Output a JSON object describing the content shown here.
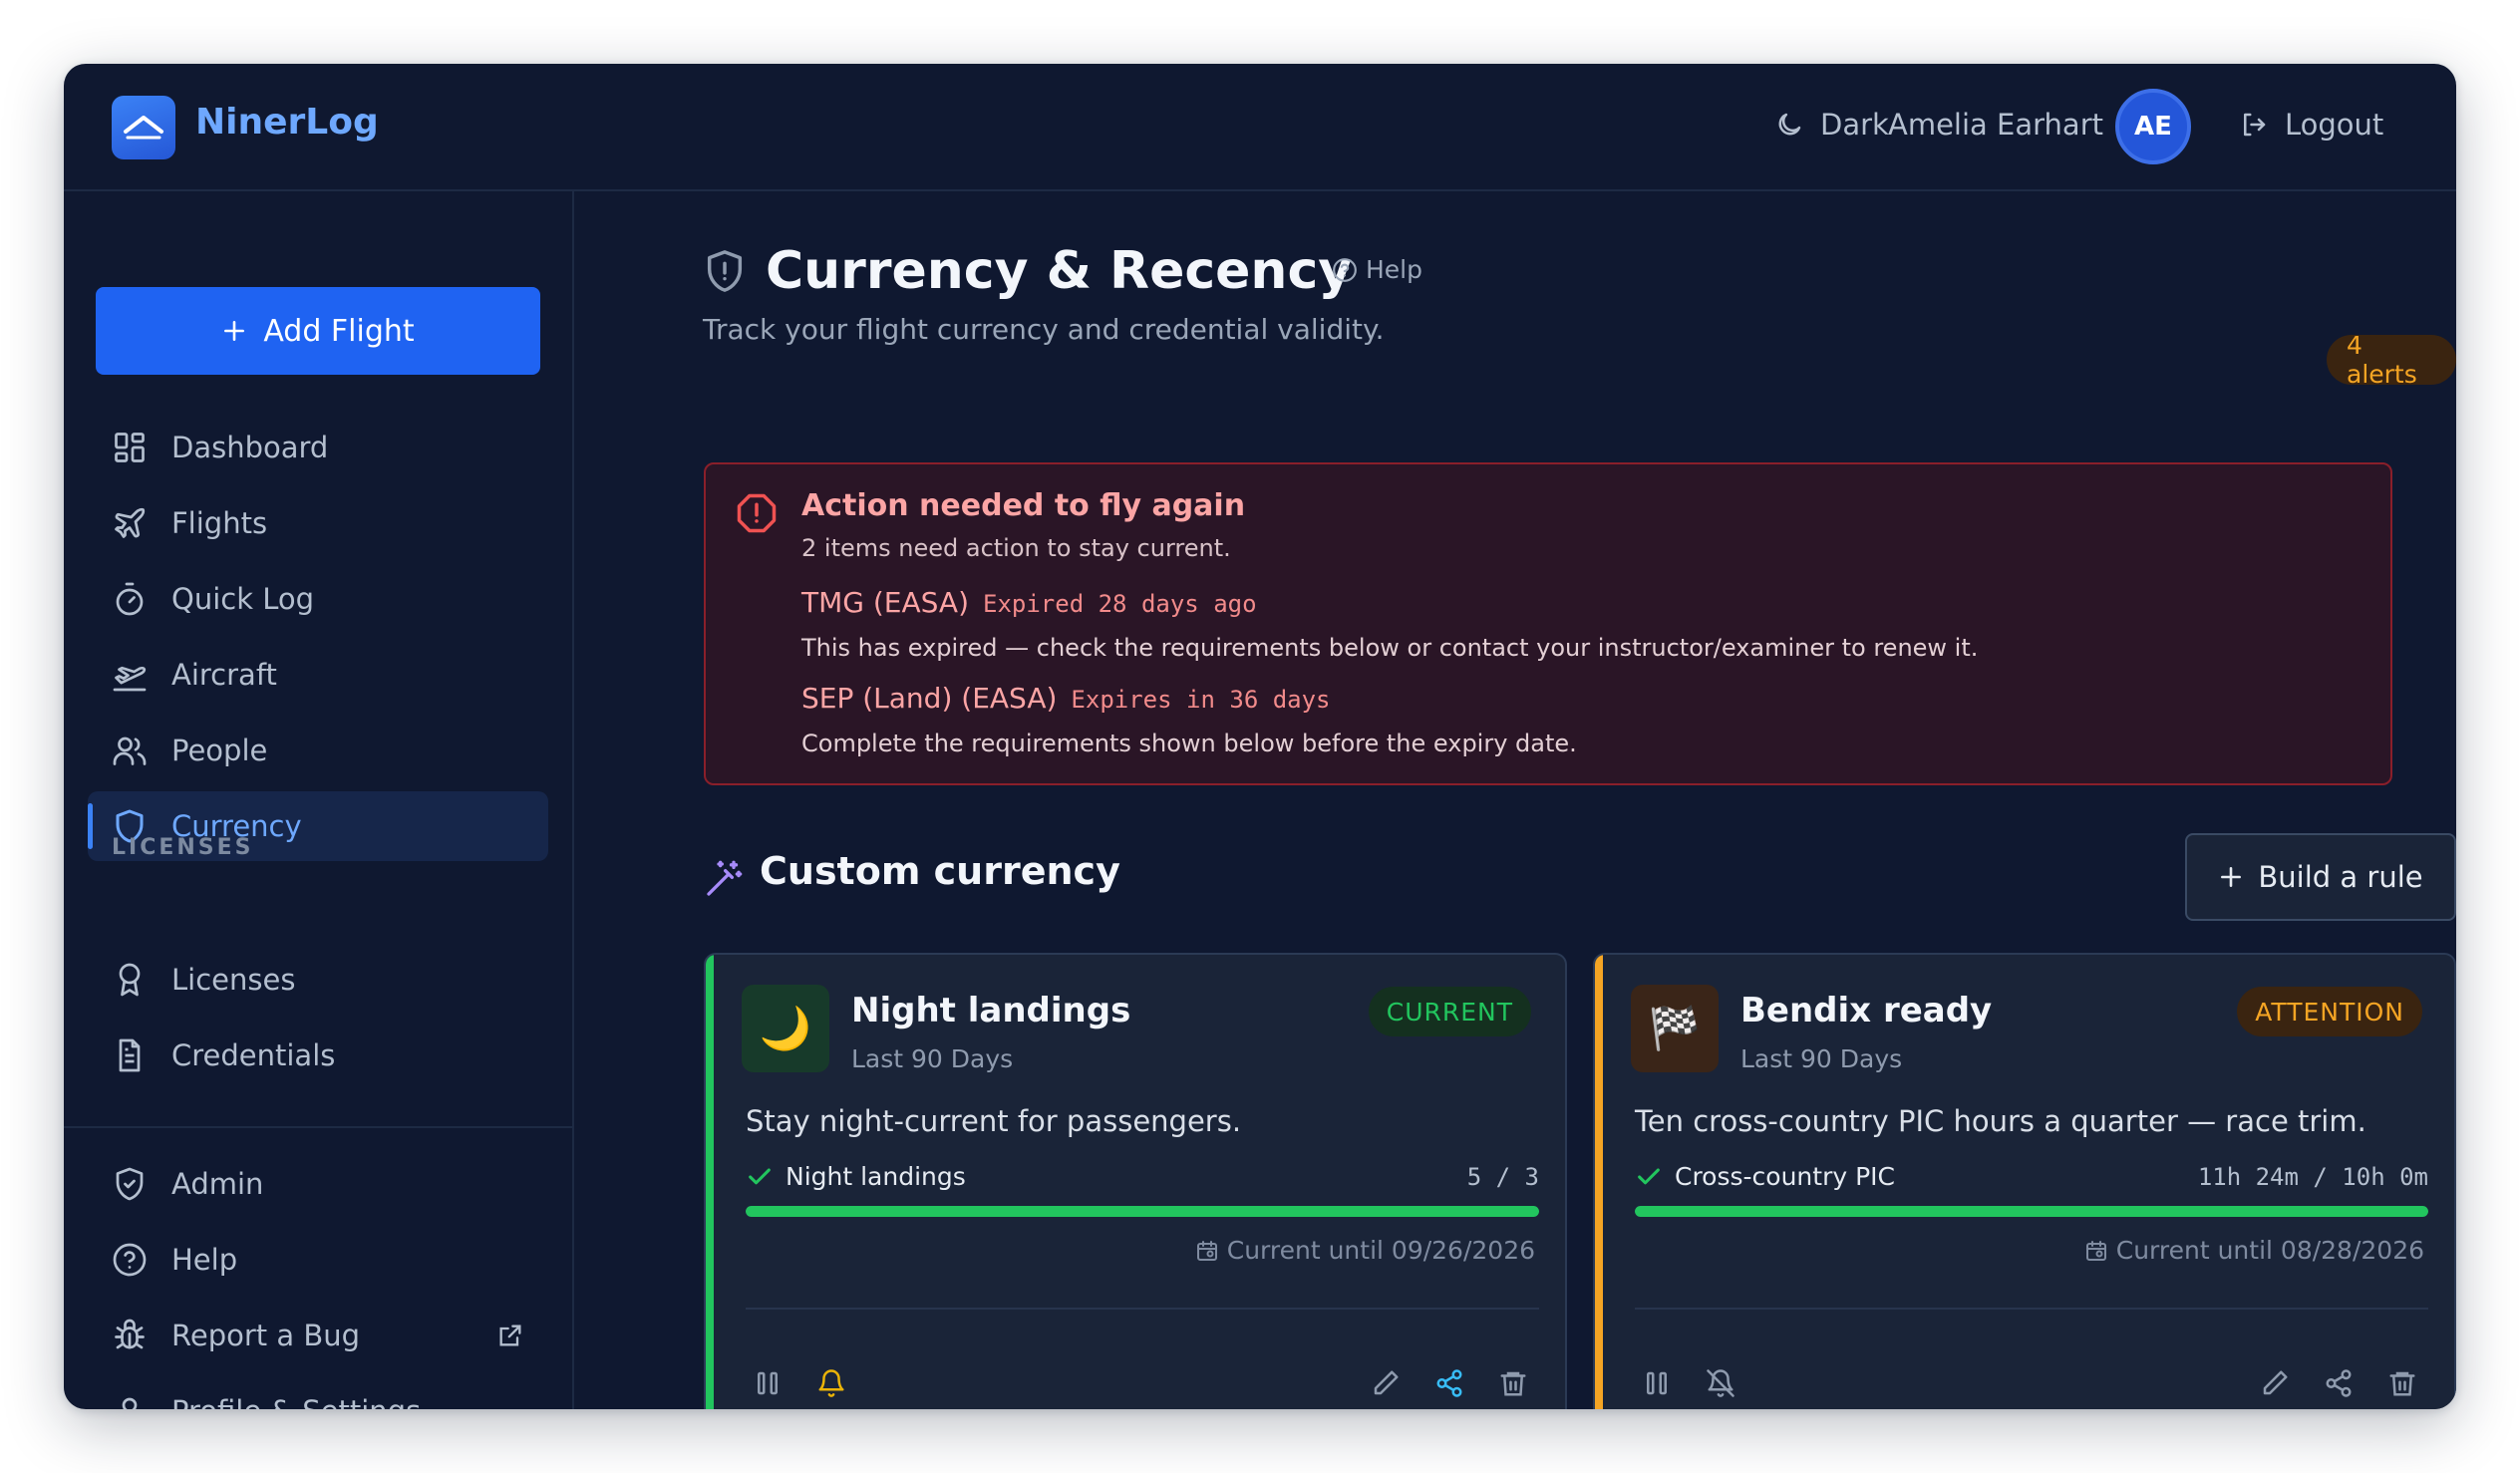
{
  "app": {
    "name": "NinerLog"
  },
  "header": {
    "theme_label": "Dark",
    "user_name": "Amelia Earhart",
    "user_initials": "AE",
    "logout_label": "Logout"
  },
  "sidebar": {
    "add_flight_label": "Add Flight",
    "items": [
      {
        "label": "Dashboard",
        "icon": "dashboard-icon"
      },
      {
        "label": "Flights",
        "icon": "plane-icon"
      },
      {
        "label": "Quick Log",
        "icon": "stopwatch-icon"
      },
      {
        "label": "Aircraft",
        "icon": "plane-takeoff-icon"
      },
      {
        "label": "People",
        "icon": "users-icon"
      },
      {
        "label": "Currency",
        "icon": "shield-icon",
        "active": true
      }
    ],
    "licenses_section_label": "LICENSES",
    "license_items": [
      {
        "label": "Licenses",
        "icon": "award-icon"
      },
      {
        "label": "Credentials",
        "icon": "document-icon"
      }
    ],
    "bottom_items": [
      {
        "label": "Admin",
        "icon": "shield-check-icon"
      },
      {
        "label": "Help",
        "icon": "help-circle-icon"
      },
      {
        "label": "Report a Bug",
        "icon": "bug-icon"
      },
      {
        "label": "Profile & Settings",
        "icon": "user-icon"
      }
    ]
  },
  "page": {
    "title": "Currency & Recency",
    "help_label": "Help",
    "subtitle": "Track your flight currency and credential validity.",
    "alerts_badge": "4 alerts"
  },
  "alert": {
    "title": "Action needed to fly again",
    "subtitle": "2 items need action to stay current.",
    "items": [
      {
        "name": "TMG (EASA)",
        "status": "Expired 28 days ago",
        "description": "This has expired — check the requirements below or contact your instructor/examiner to renew it."
      },
      {
        "name": "SEP (Land) (EASA)",
        "status": "Expires in 36 days",
        "description": "Complete the requirements shown below before the expiry date."
      }
    ]
  },
  "custom": {
    "title": "Custom currency",
    "build_rule_label": "Build a rule",
    "cards": [
      {
        "title": "Night landings",
        "period": "Last 90 Days",
        "status": "CURRENT",
        "status_color": "#22c55e",
        "accent_color": "#22c55e",
        "icon": "moon-icon",
        "icon_glyph": "🌙",
        "description": "Stay night-current for passengers.",
        "requirement_label": "Night landings",
        "requirement_value": "5 / 3",
        "progress": 1.0,
        "until": "Current until 09/26/2026",
        "notifications_on": true
      },
      {
        "title": "Bendix ready",
        "period": "Last 90 Days",
        "status": "ATTENTION",
        "status_color": "#f5a524",
        "accent_color": "#f5a524",
        "icon": "checkered-flag-icon",
        "icon_glyph": "🏁",
        "description": "Ten cross-country PIC hours a quarter — race trim.",
        "requirement_label": "Cross-country PIC",
        "requirement_value": "11h 24m / 10h 0m",
        "progress": 1.0,
        "until": "Current until 08/28/2026",
        "notifications_on": false
      }
    ]
  }
}
